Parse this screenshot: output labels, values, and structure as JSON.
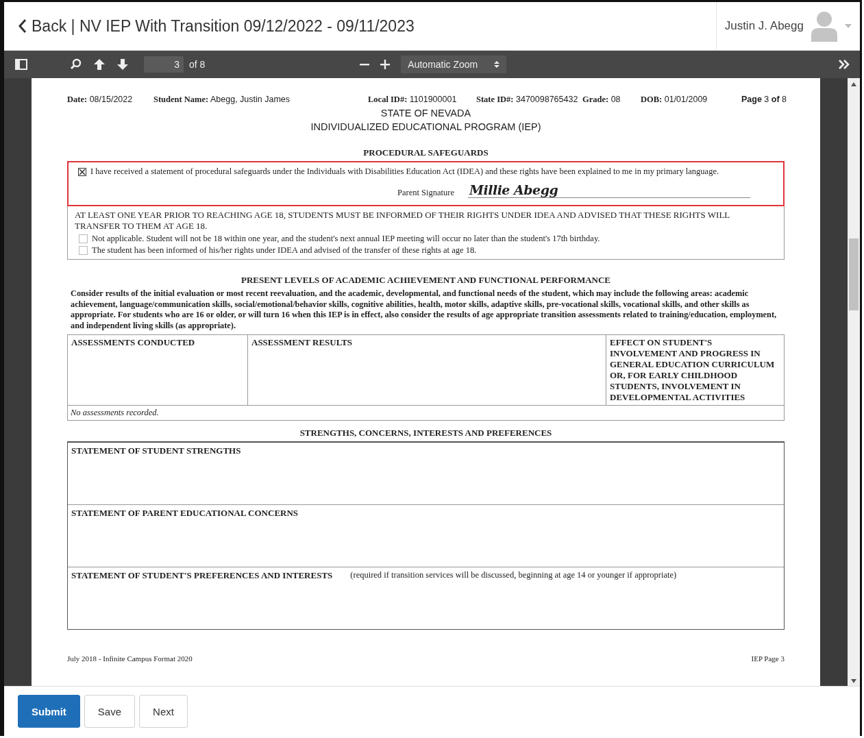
{
  "header": {
    "title": "Back | NV IEP With Transition 09/12/2022 - 09/11/2023",
    "user_name": "Justin J. Abegg"
  },
  "toolbar": {
    "page_number": "3",
    "page_count": "of 8",
    "zoom": "Automatic Zoom"
  },
  "document": {
    "fields": [
      {
        "label": "Date:",
        "value": "08/15/2022"
      },
      {
        "label": "Student Name:",
        "value": "Abegg, Justin James"
      },
      {
        "label": "Local ID#:",
        "value": "1101900001"
      },
      {
        "label": "State ID#:",
        "value": "3470098765432"
      },
      {
        "label": "Grade:",
        "value": "08"
      },
      {
        "label": "DOB:",
        "value": "01/01/2009"
      }
    ],
    "page_label": "**Page** 3 **of** 8",
    "state": "STATE OF NEVADA",
    "program": "INDIVIDUALIZED EDUCATIONAL PROGRAM (IEP)",
    "safeguards": {
      "title": "PROCEDURAL SAFEGUARDS",
      "statement": "I have received a statement of procedural safeguards under the Individuals with Disabilities Education Act (IDEA) and these rights have been explained to me in my primary language.",
      "checked": true,
      "signature_label": "Parent Signature",
      "signature": "Millie Abegg"
    },
    "transfer": {
      "text": "AT LEAST ONE YEAR PRIOR TO REACHING AGE 18, STUDENTS MUST BE INFORMED OF THEIR RIGHTS UNDER IDEA AND ADVISED THAT THESE RIGHTS WILL TRANSFER TO THEM AT AGE 18.",
      "options": [
        {
          "label": "Not applicable. Student will not be 18 within one year, and the student's next annual IEP meeting will occur no later than the student's 17th birthday.",
          "checked": false
        },
        {
          "label": "The student has been informed of his/her rights under IDEA and advised of the transfer of these rights at age 18.",
          "checked": false
        }
      ]
    },
    "plaafp": {
      "title": "PRESENT LEVELS OF ACADEMIC ACHIEVEMENT AND FUNCTIONAL PERFORMANCE",
      "intro": "Consider results of the initial evaluation or most recent reevaluation, and the academic, developmental, and functional needs of the student, which may include the following areas: academic achievement, language/communication skills, social/emotional/behavior skills, cognitive abilities, health, motor skills, adaptive skills, pre-vocational skills, vocational skills, and other skills as appropriate. For students who are 16 or older, or will turn 16 when this IEP is in effect, also consider the results of age appropriate transition assessments related to training/education, employment, and independent living skills (as appropriate).",
      "columns": [
        "ASSESSMENTS CONDUCTED",
        "ASSESSMENT RESULTS",
        "EFFECT ON STUDENT'S INVOLVEMENT AND PROGRESS IN GENERAL EDUCATION CURRICULUM OR, FOR EARLY CHILDHOOD STUDENTS, INVOLVEMENT IN DEVELOPMENTAL ACTIVITIES"
      ],
      "empty_note": "No assessments recorded."
    },
    "strengths": {
      "title": "STRENGTHS, CONCERNS, INTERESTS AND PREFERENCES",
      "rows": [
        {
          "heading": "STATEMENT OF STUDENT STRENGTHS"
        },
        {
          "heading": "STATEMENT OF PARENT EDUCATIONAL CONCERNS"
        },
        {
          "heading": "STATEMENT OF STUDENT'S PREFERENCES AND INTERESTS",
          "note": "(required if transition services will be discussed, beginning at age 14 or younger if appropriate)"
        }
      ]
    },
    "footer_left": "July 2018 - Infinite Campus Format 2020",
    "footer_right": "IEP Page 3"
  },
  "buttons": [
    {
      "label": "Submit",
      "primary": true
    },
    {
      "label": "Save",
      "primary": false
    },
    {
      "label": "Next",
      "primary": false
    }
  ]
}
